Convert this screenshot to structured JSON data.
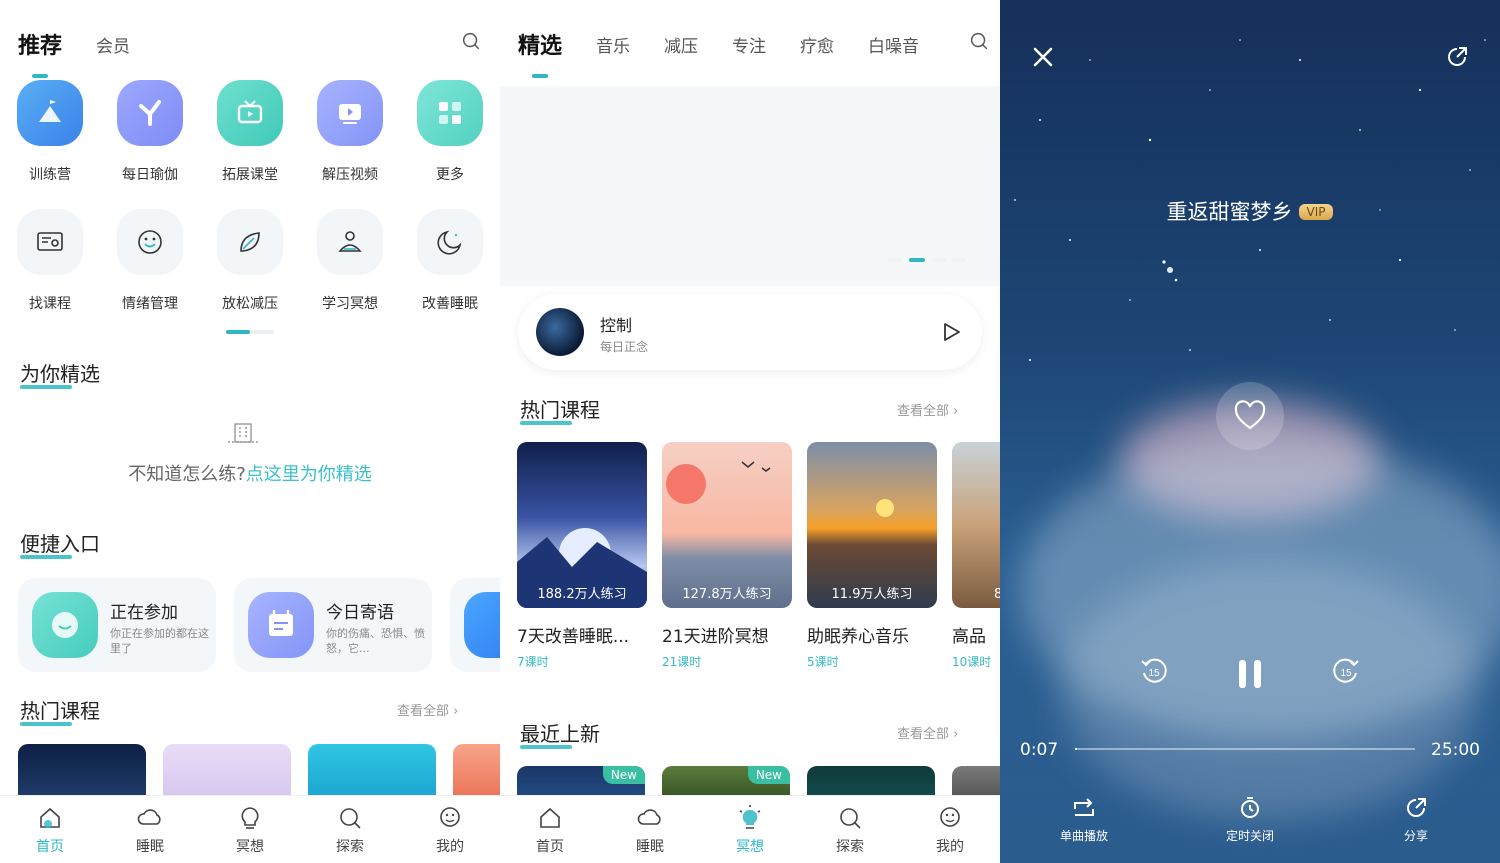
{
  "home": {
    "tabs": [
      "推荐",
      "会员"
    ],
    "grid_row1": [
      {
        "label": "训练营",
        "icon": "camp-icon"
      },
      {
        "label": "每日瑜伽",
        "icon": "yoga-icon"
      },
      {
        "label": "拓展课堂",
        "icon": "tv-icon"
      },
      {
        "label": "解压视频",
        "icon": "video-icon"
      },
      {
        "label": "更多",
        "icon": "grid-icon"
      }
    ],
    "grid_row2": [
      {
        "label": "找课程",
        "icon": "find-course-icon"
      },
      {
        "label": "情绪管理",
        "icon": "smile-icon"
      },
      {
        "label": "放松减压",
        "icon": "leaf-icon"
      },
      {
        "label": "学习冥想",
        "icon": "meditate-icon"
      },
      {
        "label": "改善睡眠",
        "icon": "moon-icon"
      }
    ],
    "for_you_title": "为你精选",
    "hint_prefix": "不知道怎么练?",
    "hint_link": "点这里为你精选",
    "quick_title": "便捷入口",
    "quick": [
      {
        "title": "正在参加",
        "desc": "你正在参加的都在这里了"
      },
      {
        "title": "今日寄语",
        "desc": "你的伤痛、恐惧、愤怒，它..."
      }
    ],
    "hot_title": "热门课程",
    "see_all": "查看全部"
  },
  "select": {
    "tabs": [
      "精选",
      "音乐",
      "减压",
      "专注",
      "疗愈",
      "白噪音"
    ],
    "player": {
      "title": "控制",
      "subtitle": "每日正念"
    },
    "hot_title": "热门课程",
    "see_all": "查看全部",
    "courses": [
      {
        "count": "188.2万人练习",
        "title": "7天改善睡眠...",
        "lessons": "7课时"
      },
      {
        "count": "127.8万人练习",
        "title": "21天进阶冥想",
        "lessons": "21课时"
      },
      {
        "count": "11.9万人练习",
        "title": "助眠养心音乐",
        "lessons": "5课时"
      },
      {
        "count": "8",
        "title": "高品",
        "lessons": "10课时"
      }
    ],
    "new_title": "最近上新",
    "new_see_all": "查看全部",
    "new_tag": "New"
  },
  "nav": {
    "items": [
      {
        "label": "首页",
        "icon": "home-icon"
      },
      {
        "label": "睡眠",
        "icon": "cloud-icon"
      },
      {
        "label": "冥想",
        "icon": "bulb-icon"
      },
      {
        "label": "探索",
        "icon": "explore-icon"
      },
      {
        "label": "我的",
        "icon": "profile-icon"
      }
    ]
  },
  "player": {
    "track": "重返甜蜜梦乡",
    "badge": "VIP",
    "current_time": "0:07",
    "total_time": "25:00",
    "progress": 0.005,
    "options": [
      "单曲播放",
      "定时关闭",
      "分享"
    ],
    "skip_seconds": "15"
  },
  "colors": {
    "accent": "#2fb8c4",
    "link": "#3cc0c9"
  }
}
